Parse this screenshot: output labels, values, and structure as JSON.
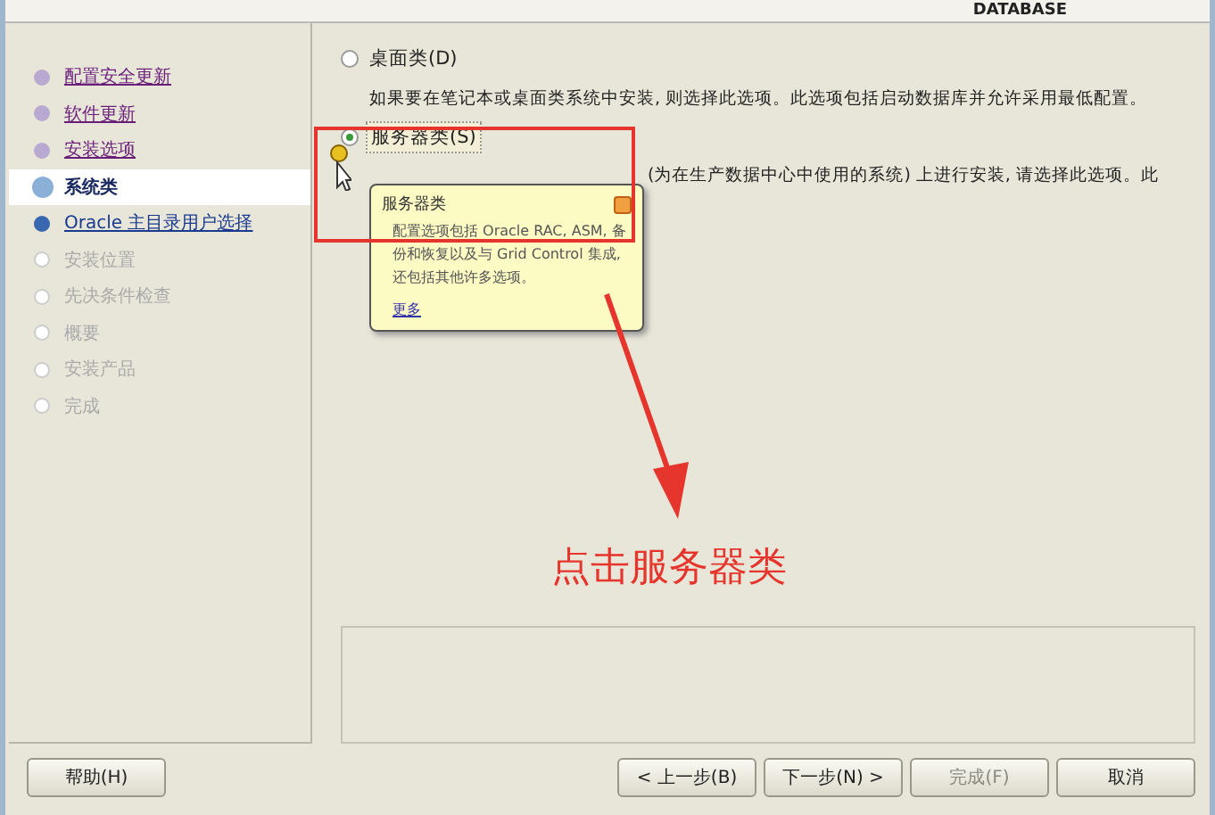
{
  "header": {
    "product": "DATABASE"
  },
  "steps": [
    {
      "label": "配置安全更新",
      "kind": "done",
      "selected": false
    },
    {
      "label": "软件更新",
      "kind": "done",
      "selected": false
    },
    {
      "label": "安装选项",
      "kind": "done",
      "selected": false
    },
    {
      "label": "系统类",
      "kind": "current",
      "selected": true
    },
    {
      "label": "Oracle 主目录用户选择",
      "kind": "next",
      "selected": false
    },
    {
      "label": "安装位置",
      "kind": "pending",
      "selected": false
    },
    {
      "label": "先决条件检查",
      "kind": "pending",
      "selected": false
    },
    {
      "label": "概要",
      "kind": "pending",
      "selected": false
    },
    {
      "label": "安装产品",
      "kind": "pending",
      "selected": false
    },
    {
      "label": "完成",
      "kind": "pending",
      "selected": false
    }
  ],
  "options": [
    {
      "label": "桌面类(D)",
      "selected": false,
      "description": "如果要在笔记本或桌面类系统中安装, 则选择此选项。此选项包括启动数据库并允许采用最低配置。"
    },
    {
      "label": "服务器类(S)",
      "selected": true,
      "description": "(为在生产数据中心中使用的系统) 上进行安装, 请选择此选项。此"
    }
  ],
  "tooltip": {
    "title": "服务器类",
    "text": "配置选项包括 Oracle RAC, ASM, 备份和恢复以及与 Grid Control 集成, 还包括其他许多选项。",
    "link": "更多"
  },
  "annotation": {
    "text": "点击服务器类"
  },
  "buttons": [
    {
      "label": "帮助(H)",
      "kind": "help",
      "disabled": false
    },
    {
      "label": "< 上一步(B)",
      "kind": "nav",
      "disabled": false
    },
    {
      "label": "下一步(N) >",
      "kind": "nav",
      "disabled": false
    },
    {
      "label": "完成(F)",
      "kind": "nav",
      "disabled": true
    },
    {
      "label": "取消",
      "kind": "nav",
      "disabled": false
    }
  ]
}
